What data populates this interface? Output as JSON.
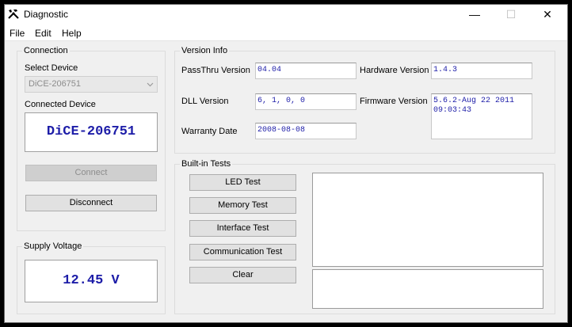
{
  "window": {
    "title": "Diagnostic",
    "minimize": "—",
    "maximize": "☐",
    "close": "✕"
  },
  "menu": [
    "File",
    "Edit",
    "Help"
  ],
  "connection": {
    "group_title": "Connection",
    "select_device_label": "Select Device",
    "select_device_value": "DiCE-206751",
    "connected_device_label": "Connected Device",
    "connected_device_value": "DiCE-206751",
    "connect_label": "Connect",
    "disconnect_label": "Disconnect"
  },
  "supply": {
    "group_title": "Supply Voltage",
    "value": "12.45 V"
  },
  "version": {
    "group_title": "Version Info",
    "passthru_label": "PassThru Version",
    "passthru_value": "04.04",
    "hardware_label": "Hardware Version",
    "hardware_value": "1.4.3",
    "dll_label": "DLL Version",
    "dll_value": "6, 1, 0, 0",
    "firmware_label": "Firmware Version",
    "firmware_value": "5.6.2-Aug 22 2011\n09:03:43",
    "warranty_label": "Warranty Date",
    "warranty_value": "2008-08-08"
  },
  "tests": {
    "group_title": "Built-in Tests",
    "led_label": "LED Test",
    "memory_label": "Memory Test",
    "interface_label": "Interface Test",
    "communication_label": "Communication Test",
    "clear_label": "Clear"
  }
}
